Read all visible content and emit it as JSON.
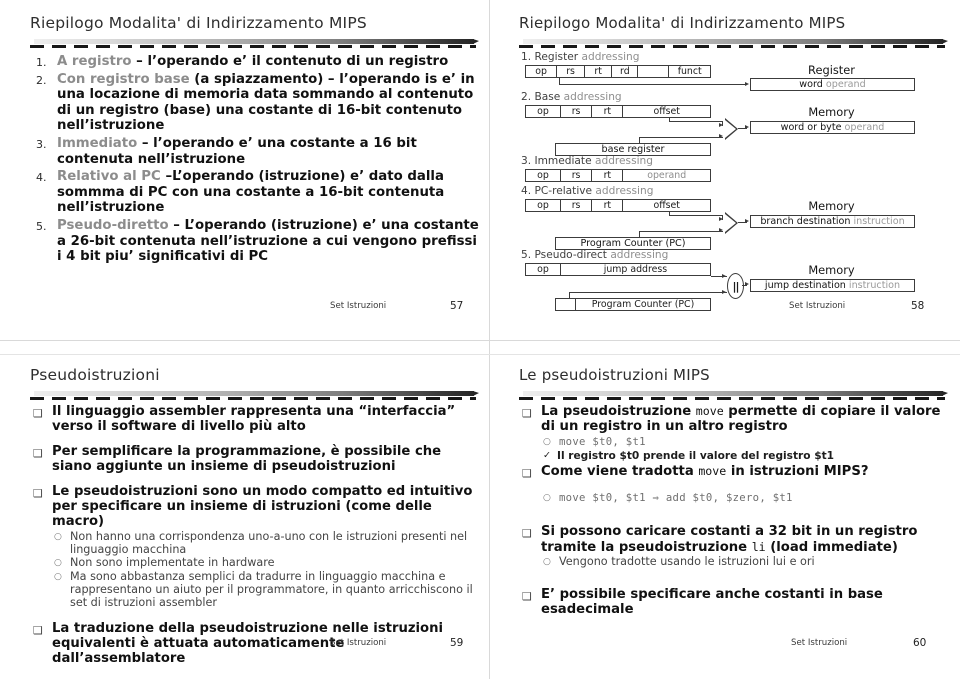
{
  "slide57": {
    "title": "Riepilogo Modalita' di Indirizzamento MIPS",
    "items": [
      {
        "num": "1.",
        "dim": "A registro",
        "rest": " – l’operando e’ il contenuto di un registro"
      },
      {
        "num": "2.",
        "dim": "Con registro base",
        "rest": " (a spiazzamento) – l’operando is e’ in una locazione di memoria data sommando al contenuto di un registro (base) una costante di 16-bit contenuto nell’istruzione"
      },
      {
        "num": "3.",
        "dim": "Immediato",
        "rest": " – l’operando e’ una costante a 16 bit contenuta nell’istruzione"
      },
      {
        "num": "4.",
        "dim": "Relativo al PC",
        "rest": " –L’operando (istruzione) e’ dato dalla sommma di PC con una costante a 16-bit contenuta nell’istruzione"
      },
      {
        "num": "5.",
        "dim": "Pseudo-diretto",
        "rest": " – L’operando (istruzione) e’ una costante a 26-bit contenuta nell’istruzione a cui vengono prefissi i 4 bit piu’ significativi di PC"
      }
    ],
    "footer": "Set Istruzioni",
    "page": "57"
  },
  "slide58": {
    "title": "Riepilogo Modalita' di Indirizzamento MIPS",
    "sections": [
      {
        "heading_num": "1.",
        "heading_plain": "Register",
        "heading_dim": " addressing",
        "fields": [
          "op",
          "rs",
          "rt",
          "rd",
          "",
          "funct"
        ],
        "unit": "Register",
        "unit_box": "word",
        "unit_box_dim": "operand"
      },
      {
        "heading_num": "2.",
        "heading_plain": "Base",
        "heading_dim": " addressing",
        "fields": [
          "op",
          "rs",
          "rt",
          "offset"
        ],
        "second_box": "base register",
        "unit": "Memory",
        "unit_box": "word or byte",
        "unit_box_dim": "operand"
      },
      {
        "heading_num": "3.",
        "heading_plain": "Immediate",
        "heading_dim": " addressing",
        "fields": [
          "op",
          "rs",
          "rt",
          "operand"
        ]
      },
      {
        "heading_num": "4.",
        "heading_plain": "PC-relative",
        "heading_dim": " addressing",
        "fields": [
          "op",
          "rs",
          "rt",
          "offset"
        ],
        "second_box": "Program Counter (PC)",
        "unit": "Memory",
        "unit_box": "branch destination",
        "unit_box_dim": "instruction"
      },
      {
        "heading_num": "5.",
        "heading_plain": "Pseudo-direct",
        "heading_dim": " addressing",
        "fields": [
          "op",
          "jump address"
        ],
        "second_box": "Program Counter (PC)",
        "unit": "Memory",
        "unit_box": "jump destination",
        "unit_box_dim": "instruction",
        "operator": "||"
      }
    ],
    "footer": "Set Istruzioni",
    "page": "58"
  },
  "slide59": {
    "title": "Pseudoistruzioni",
    "bullets": [
      {
        "text": "Il linguaggio assembler rappresenta una “interfaccia” verso il software di livello più alto"
      },
      {
        "text": "Per semplificare la programmazione, è possibile che siano aggiunte un insieme di pseudoistruzioni"
      },
      {
        "text": "Le pseudoistruzioni sono un modo compatto ed intuitivo per specificare un insieme di istruzioni (come delle macro)",
        "sub": [
          "Non hanno una corrispondenza uno-a-uno con le istruzioni presenti nel linguaggio macchina",
          "Non sono implementate in hardware",
          "Ma sono abbastanza semplici da tradurre in linguaggio macchina e rappresentano un aiuto per il programmatore, in quanto arricchiscono il set di istruzioni assembler"
        ]
      },
      {
        "text": "La traduzione della pseudoistruzione nelle istruzioni equivalenti è attuata automaticamente dall’assemblatore"
      }
    ],
    "footer": "Set Istruzioni",
    "page": "59"
  },
  "slide60": {
    "title": "Le pseudoistruzioni MIPS",
    "bullets": [
      {
        "pre": "La pseudoistruzione ",
        "mono": "move",
        "post": " permette di copiare il valore di un registro in un altro registro",
        "sub_code": [
          "move $t0, $t1"
        ],
        "check": [
          "Il registro $t0 prende il valore del registro $t1"
        ]
      },
      {
        "pre": "Come viene tradotta ",
        "mono": "move",
        "post": " in istruzioni MIPS?",
        "sub_code": [
          "move $t0, $t1 ⇒ add $t0, $zero, $t1"
        ]
      },
      {
        "pre": "Si possono caricare costanti a 32 bit in un registro tramite la pseudoistruzione ",
        "mono": "li",
        "post": " (load immediate)",
        "sub": [
          "Vengono tradotte usando le istruzioni lui e ori"
        ]
      },
      {
        "pre": "E’ possibile specificare anche costanti in base esadecimale",
        "mono": "",
        "post": ""
      }
    ],
    "footer": "Set Istruzioni",
    "page": "60"
  },
  "colors": {
    "ink": "#111111",
    "dim": "#8c8c8c",
    "rule_dark": "#262626",
    "grid": "#d9d9d9"
  }
}
